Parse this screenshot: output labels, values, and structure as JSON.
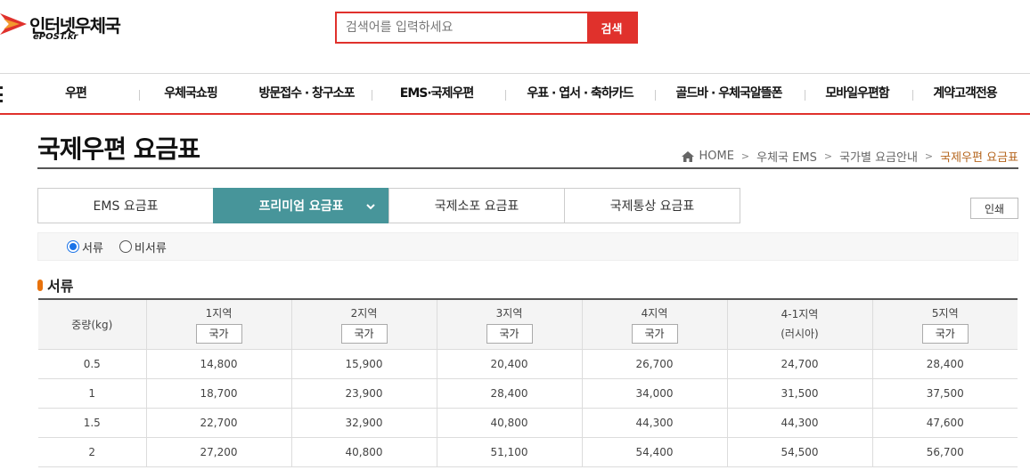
{
  "header": {
    "logo_main": "인터넷우체국",
    "logo_sub": "ePOST.kr",
    "search_placeholder": "검색어를 입력하세요",
    "search_button": "검색"
  },
  "gnb": {
    "items": [
      "우편",
      "우체국쇼핑",
      "방문접수 · 창구소포",
      "EMS·국제우편",
      "우표 · 엽서 · 축하카드",
      "골드바 · 우체국알뜰폰",
      "모바일우편함",
      "계약고객전용"
    ]
  },
  "page": {
    "title": "국제우편 요금표",
    "breadcrumb": [
      "HOME",
      "우체국 EMS",
      "국가별 요금안내",
      "국제우편 요금표"
    ]
  },
  "tabs": [
    "EMS 요금표",
    "프리미엄 요금표",
    "국제소포 요금표",
    "국제통상 요금표"
  ],
  "active_tab": 1,
  "print_label": "인쇄",
  "radios": {
    "option1": "서류",
    "option2": "비서류",
    "selected": "서류"
  },
  "section_title": "서류",
  "table": {
    "weight_header": "중량(kg)",
    "country_button": "국가",
    "zones": [
      {
        "name": "1지역",
        "sub": "국가",
        "button": true
      },
      {
        "name": "2지역",
        "sub": "국가",
        "button": true
      },
      {
        "name": "3지역",
        "sub": "국가",
        "button": true
      },
      {
        "name": "4지역",
        "sub": "국가",
        "button": true
      },
      {
        "name": "4-1지역",
        "sub": "(러시아)",
        "button": false
      },
      {
        "name": "5지역",
        "sub": "국가",
        "button": true
      }
    ],
    "rows": [
      [
        "0.5",
        "14,800",
        "15,900",
        "20,400",
        "26,700",
        "24,700",
        "28,400"
      ],
      [
        "1",
        "18,700",
        "23,900",
        "28,400",
        "34,000",
        "31,500",
        "37,500"
      ],
      [
        "1.5",
        "22,700",
        "32,900",
        "40,800",
        "44,300",
        "44,300",
        "47,600"
      ],
      [
        "2",
        "27,200",
        "40,800",
        "51,100",
        "54,400",
        "54,500",
        "56,700"
      ]
    ]
  },
  "colors": {
    "brand_red": "#e0312c",
    "tab_active": "#47959a",
    "bullet_orange": "#e8720c",
    "breadcrumb_current": "#b5651d"
  },
  "icons": [
    "epost-logo-icon",
    "home-icon",
    "chevron-down-icon",
    "menu-icon"
  ]
}
